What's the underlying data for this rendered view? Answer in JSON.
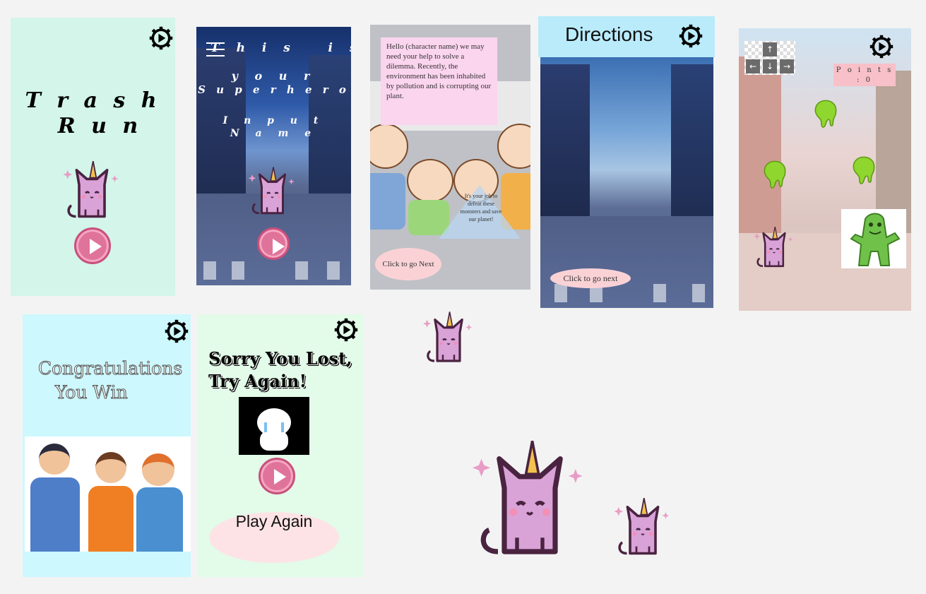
{
  "screens": {
    "title": {
      "word1": "T r a s h",
      "word2": "R u n"
    },
    "name_entry": {
      "line1": "T h i s   i s",
      "line2": "y o u r",
      "line3": "S u p e r h e r o",
      "line4": "I n p u t",
      "line5": "N a m e"
    },
    "story": {
      "message": "Hello (character name) we may need your help to solve a dilemma. Recently, the environment has been inhabited by pollution and is corrupting our plant.",
      "overlay": "It's your job to defeat these monsters and save our planet!",
      "next_button": "Click to go Next"
    },
    "directions": {
      "title": "Directions",
      "next_button": "Click to go next"
    },
    "game": {
      "points_label": "P o i n t s",
      "points_value": ": 0"
    },
    "win": {
      "line1": "Congratulations",
      "line2": "You Win"
    },
    "lose": {
      "line1": "Sorry You Lost,",
      "line2": "Try Again!",
      "play_again": "Play Again"
    }
  },
  "icons": {
    "settings": "gear-icon",
    "play": "play-icon",
    "menu": "hamburger-icon",
    "arrows": [
      "arrow-up-icon",
      "arrow-left-icon",
      "arrow-down-icon",
      "arrow-right-icon"
    ]
  },
  "colors": {
    "mint": "#d3f5ea",
    "light_cyan": "#cdf8fd",
    "light_green": "#e3fbe9",
    "directions_header": "#b9ebfb",
    "play_pink": "#e0739a",
    "unicat": "#d9a3d8"
  }
}
